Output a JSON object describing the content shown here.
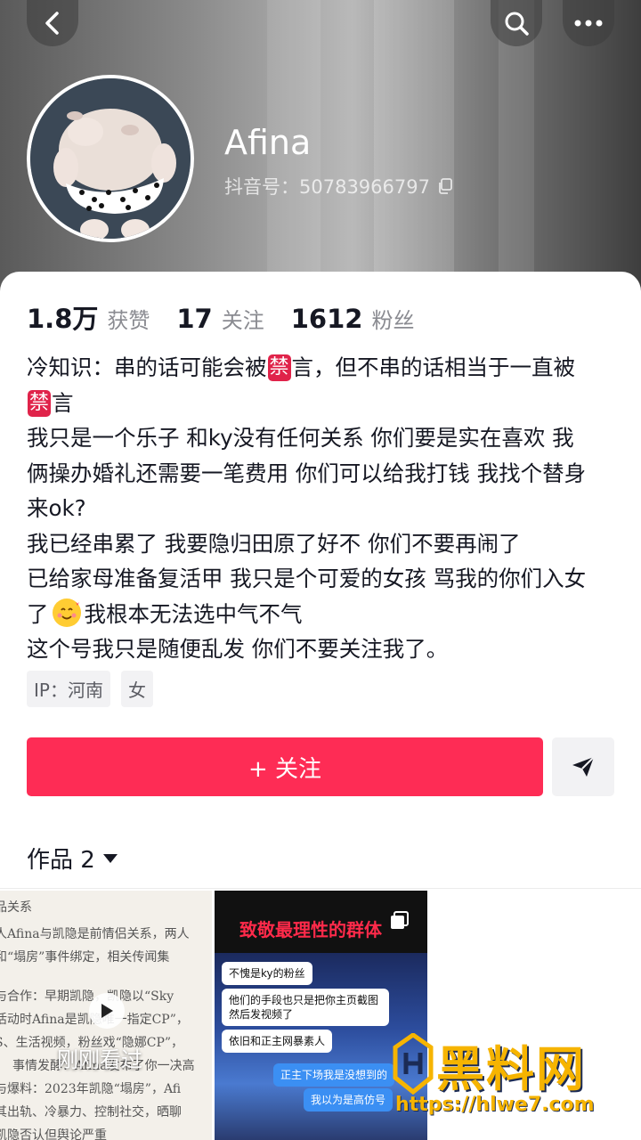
{
  "profile": {
    "nickname": "Afina",
    "douyin_id": "抖音号：50783966797"
  },
  "stats": [
    {
      "value": "1.8万",
      "label": "获赞"
    },
    {
      "value": "17",
      "label": "关注"
    },
    {
      "value": "1612",
      "label": "粉丝"
    }
  ],
  "bio": {
    "l1a": "冷知识：串的话可能会被",
    "ban": "禁",
    "l1b": "言，但不串的话相当于一直被",
    "l2b": "言",
    "l3": "我只是一个乐子 和ky没有任何关系 你们要是实在喜欢 我",
    "l4": "俩操办婚礼还需要一笔费用 你们可以给我打钱 我找个替身",
    "l5": "来ok?",
    "l6": "我已经串累了 我要隐归田原了好不 你们不要再闹了",
    "l7": "已给家母准备复活甲 我只是个可爱的女孩 骂我的你们入女",
    "l8a": "了",
    "l8b": "我根本无法选中气不气",
    "l9": "这个号我只是随便乱发 你们不要关注我了。"
  },
  "tags": [
    "IP：河南",
    "女"
  ],
  "actions": {
    "follow_label": "+ 关注"
  },
  "works": {
    "tab_label": "作品 2",
    "items": [
      {
        "overlay": "刚刚看过",
        "doc_lines": [
          "品关系",
          "人Afina与凯隐是前情侣关系，两人",
          "和“塌房”事件绑定，相关传闻集",
          "与合作：早期凯隐，凯隐以“Sky",
          "活动时Afina是凯隐唯一指定CP”，",
          "S、生活视频，粉丝戏“隐娜CP”，",
          "事情发酵：Afina发布了你一决高",
          "与爆料：2023年凯隐“塌房”，Afi",
          "其出轨、冷暴力、控制社交，晒聊",
          "凯隐否认但舆论严重"
        ]
      },
      {
        "title": "致敬最理性的群体",
        "chats": [
          "不愧是ky的粉丝",
          "他们的手段也只是把你主页截图然后发视频了",
          "依旧和正主网暴素人",
          "正主下场我是没想到的",
          "我以为是高仿号"
        ]
      }
    ]
  },
  "watermark": {
    "text": "黑料网",
    "url": "https://hlwe7.com"
  },
  "colors": {
    "accent": "#fe2c55",
    "ban_badge": "#e0234a",
    "watermark": "#f6b400"
  },
  "icons": [
    "back-arrow-icon",
    "search-icon",
    "more-icon",
    "copy-icon",
    "send-icon",
    "caret-down-icon",
    "play-icon"
  ]
}
